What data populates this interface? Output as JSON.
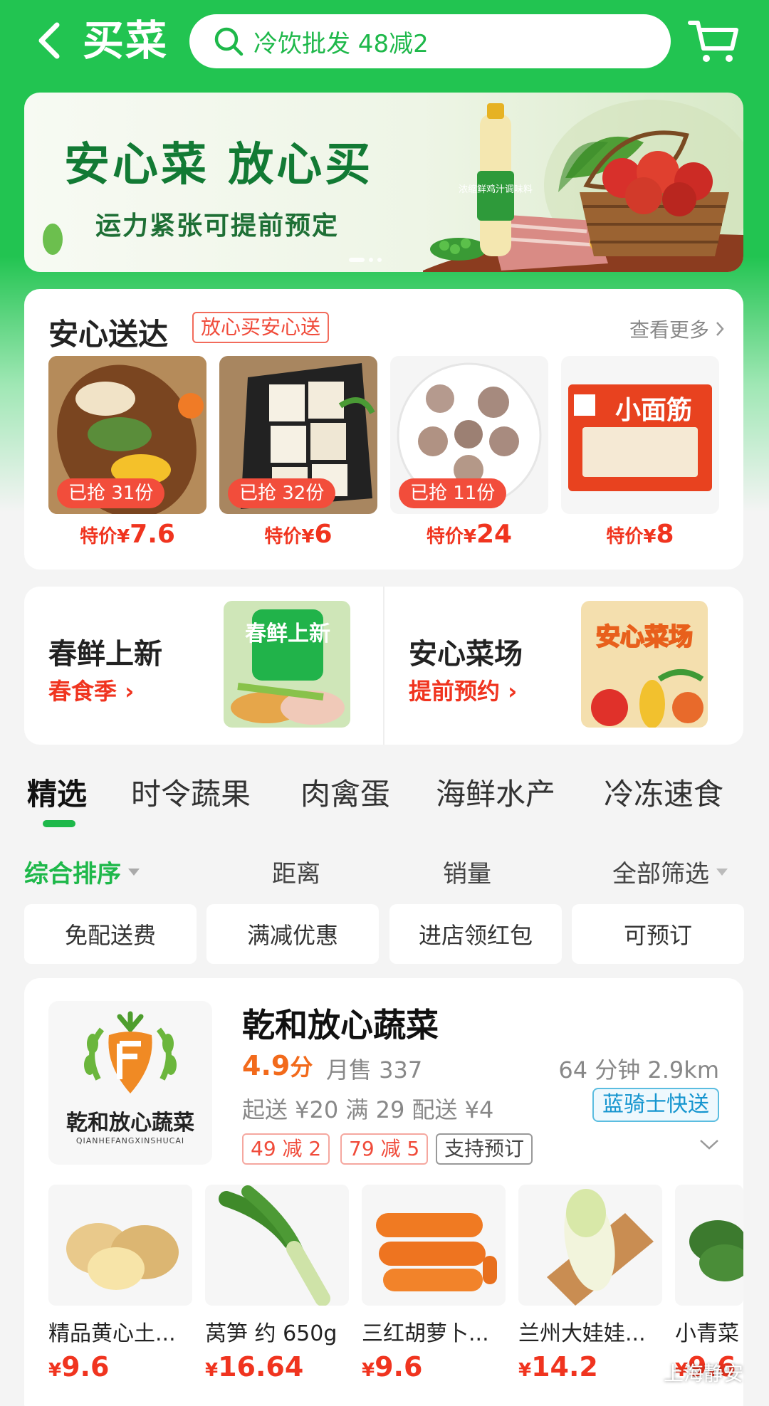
{
  "header": {
    "title": "买菜",
    "search_placeholder": "冷饮批发 48减2"
  },
  "banner": {
    "title": "安心菜  放心买",
    "subtitle": "运力紧张可提前预定",
    "bottle_label": "浓缩鲜鸡汁调味料",
    "slide_count": 3,
    "active_slide": 1
  },
  "safe_delivery": {
    "title": "安心送达",
    "tag": "放心买安心送",
    "see_more": "查看更多",
    "items": [
      {
        "badge": "已抢 31份",
        "price_prefix": "特价¥",
        "price": "7.6"
      },
      {
        "badge": "已抢 32份",
        "price_prefix": "特价¥",
        "price": "6"
      },
      {
        "badge": "已抢 11份",
        "price_prefix": "特价¥",
        "price": "24"
      },
      {
        "badge": "",
        "price_prefix": "特价¥",
        "price": "8",
        "package_label": "小面筋"
      }
    ]
  },
  "promos": [
    {
      "title": "春鲜上新",
      "link": "春食季",
      "image_label": "春鲜上新"
    },
    {
      "title": "安心菜场",
      "link": "提前预约",
      "image_label": "安心菜场"
    }
  ],
  "tabs": [
    "精选",
    "时令蔬果",
    "肉禽蛋",
    "海鲜水产",
    "冷冻速食"
  ],
  "sort": {
    "composite": "综合排序",
    "distance": "距离",
    "sales": "销量",
    "all_filters": "全部筛选"
  },
  "filters": [
    "免配送费",
    "满减优惠",
    "进店领红包",
    "可预订"
  ],
  "store": {
    "logo_text": "乾和放心蔬菜",
    "logo_sub": "QIANHEFANGXINSHUCAI",
    "name": "乾和放心蔬菜",
    "rating": "4.9",
    "rating_unit": "分",
    "monthly_sales": "月售 337",
    "eta": "64 分钟   2.9km",
    "min_order": "起送 ¥20   满 29 配送 ¥4",
    "rider": "蓝骑士快送",
    "tags": [
      "49 减 2",
      "79 减 5",
      "支持预订"
    ],
    "products": [
      {
        "name": "精品黄心土...",
        "price_prefix": "¥",
        "price": "9.6"
      },
      {
        "name": "莴笋 约 650g",
        "price_prefix": "¥",
        "price": "16.64"
      },
      {
        "name": "三红胡萝卜...",
        "price_prefix": "¥",
        "price": "9.6"
      },
      {
        "name": "兰州大娃娃...",
        "price_prefix": "¥",
        "price": "14.2"
      },
      {
        "name": "小青菜",
        "price_prefix": "¥",
        "price": "9.6"
      }
    ]
  },
  "watermark": "上海静安",
  "colors": {
    "brand_green": "#22c451",
    "price_red": "#f0341f",
    "rating_orange": "#f26a1b",
    "rider_blue": "#1595cf"
  }
}
